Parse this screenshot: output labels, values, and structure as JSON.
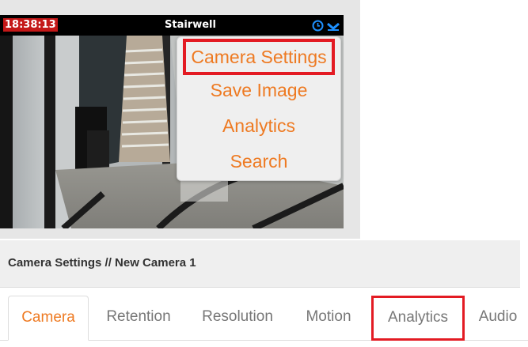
{
  "camera_tile": {
    "timestamp": "18:38:13",
    "title": "Stairwell",
    "icons": [
      "clock-icon",
      "chevron-down-icon"
    ]
  },
  "dropdown_menu": {
    "items": [
      {
        "label": "Camera Settings",
        "highlighted": true
      },
      {
        "label": "Save Image",
        "highlighted": false
      },
      {
        "label": "Analytics",
        "highlighted": false
      },
      {
        "label": "Search",
        "highlighted": false
      }
    ]
  },
  "settings": {
    "title": "Camera Settings // New Camera 1"
  },
  "tabs": [
    {
      "label": "Camera",
      "active": true
    },
    {
      "label": "Retention",
      "active": false
    },
    {
      "label": "Resolution",
      "active": false
    },
    {
      "label": "Motion",
      "active": false
    },
    {
      "label": "Analytics",
      "active": false,
      "highlighted": true
    },
    {
      "label": "Audio",
      "active": false
    }
  ],
  "colors": {
    "accent": "#ee7a22",
    "highlight_box": "#e31b23",
    "timestamp_bg": "#c41818",
    "header_bg": "#000000",
    "menu_bg": "#efefef",
    "icon_blue": "#1e90ff"
  }
}
